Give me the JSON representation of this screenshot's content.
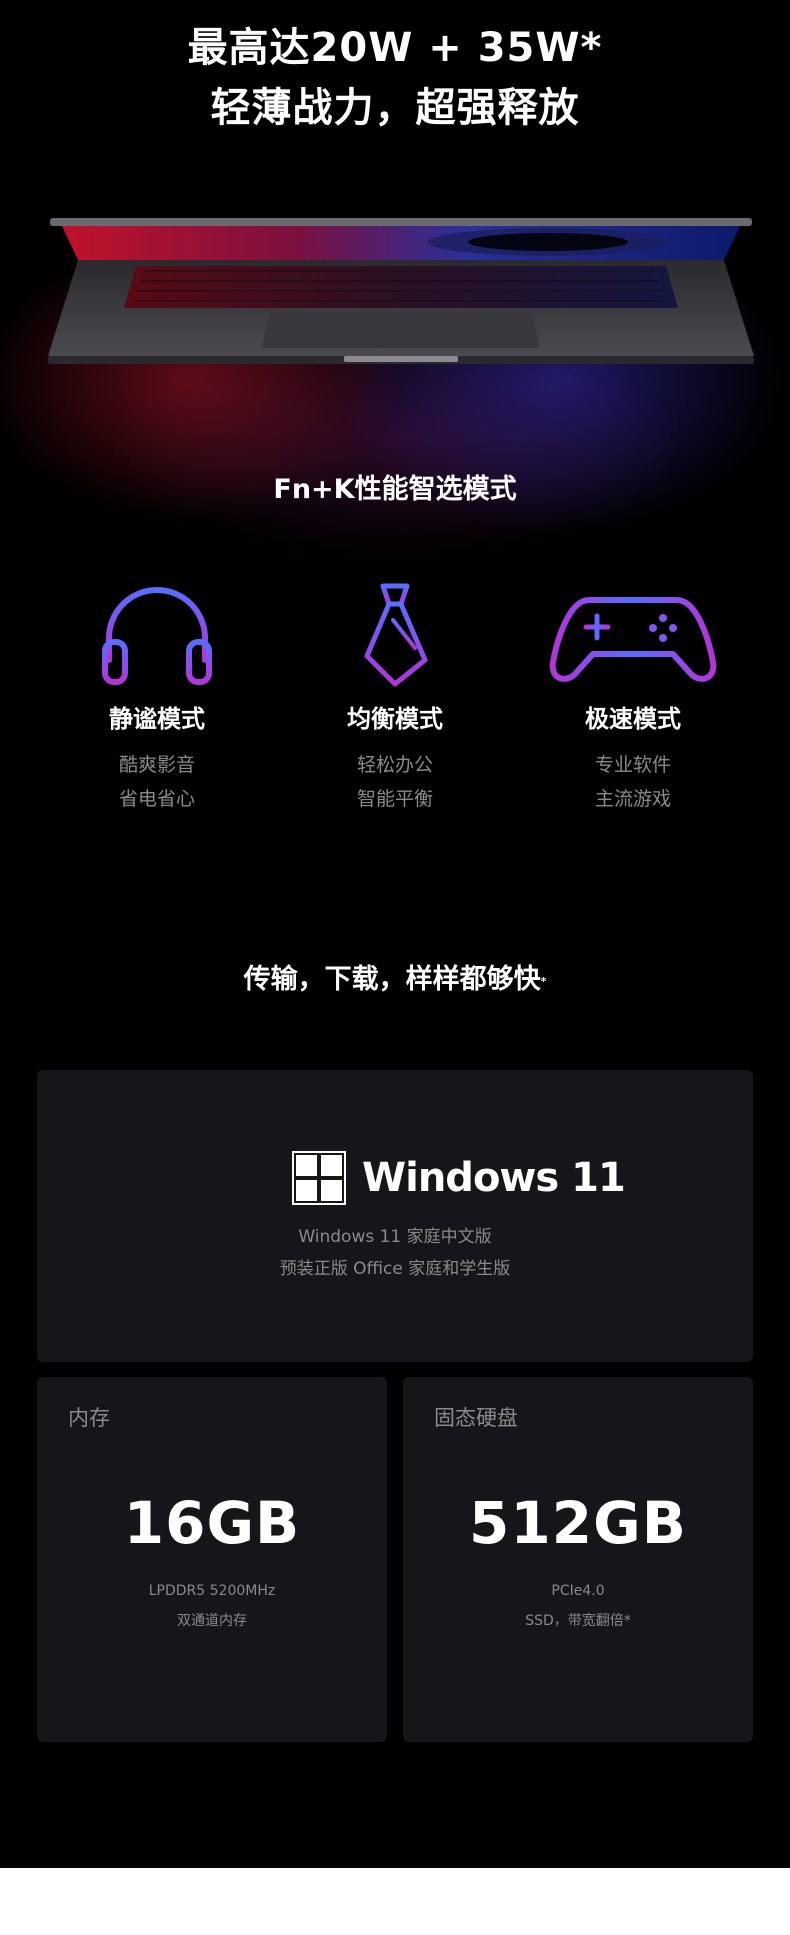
{
  "headline": {
    "line1": "最高达20W + 35W*",
    "line2": "轻薄战力，超强释放"
  },
  "modes_section": {
    "title": "Fn+K性能智选模式",
    "modes": [
      {
        "icon": "headphones-icon",
        "name": "静谧模式",
        "desc1": "酷爽影音",
        "desc2": "省电省心"
      },
      {
        "icon": "necktie-icon",
        "name": "均衡模式",
        "desc1": "轻松办公",
        "desc2": "智能平衡"
      },
      {
        "icon": "gamepad-icon",
        "name": "极速模式",
        "desc1": "专业软件",
        "desc2": "主流游戏"
      }
    ],
    "icon_gradient": [
      "#5b6cff",
      "#b235d8"
    ]
  },
  "transfer_section": {
    "title": "传输，下载，样样都够快",
    "title_mark": "*"
  },
  "windows_card": {
    "brand": "Windows 11",
    "line1": "Windows 11 家庭中文版",
    "line2": "预装正版 Office 家庭和学生版"
  },
  "memory_card": {
    "label": "内存",
    "value": "16GB",
    "sub1": "LPDDR5 5200MHz",
    "sub2": "双通道内存"
  },
  "ssd_card": {
    "label": "固态硬盘",
    "value": "512GB",
    "sub1": "PCIe4.0",
    "sub2": "SSD，带宽翻倍*"
  },
  "colors": {
    "background": "#000000",
    "card": "#16161a",
    "muted_text": "#8a8a8a"
  }
}
